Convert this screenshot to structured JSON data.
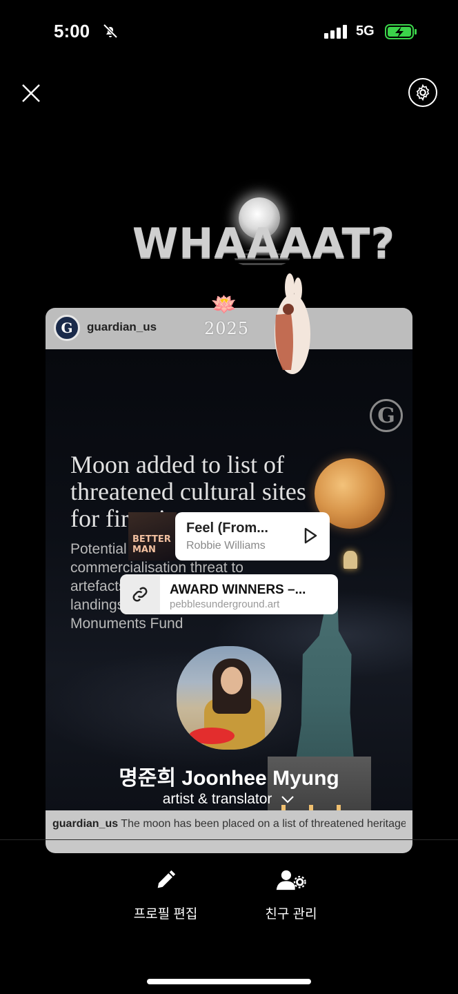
{
  "status_bar": {
    "time": "5:00",
    "network": "5G",
    "icons": [
      "bell-slash-icon",
      "signal-icon",
      "battery-charging-icon"
    ]
  },
  "top_bar": {
    "icons": [
      "close-icon",
      "gear-icon"
    ]
  },
  "stickers": {
    "text": "WHAAAAT?",
    "year": "2025"
  },
  "post": {
    "handle": "guardian_us",
    "headline": "Moon added to list of threatened cultural sites for first time",
    "subhead": "Potential looting and commercialisation threat to artefacts from moon landings, says World Monuments Fund",
    "caption_handle": "guardian_us",
    "caption_text": "The moon has been placed on a list of threatened heritage sites, owing to fears of potential looting..."
  },
  "music": {
    "title": "Feel (From...",
    "artist": "Robbie Williams",
    "cover_text": "BETTER MAN"
  },
  "link": {
    "title": "AWARD WINNERS –...",
    "url": "pebblesunderground.art"
  },
  "profile": {
    "name": "명준희 Joonhee Myung",
    "bio": "artist & translator"
  },
  "actions": [
    {
      "label": "프로필 편집",
      "icon": "pencil-icon"
    },
    {
      "label": "친구 관리",
      "icon": "user-settings-icon"
    }
  ]
}
